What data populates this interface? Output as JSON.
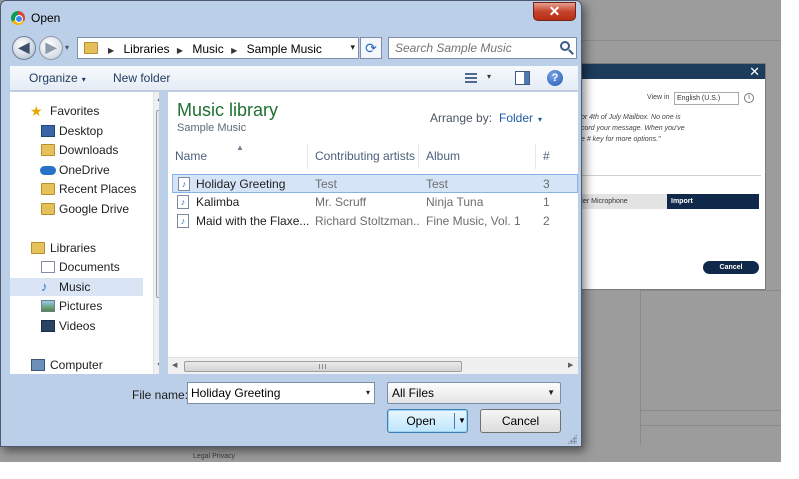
{
  "background_page": {
    "view_in_label": "View in",
    "language_value": "English (U.S.)",
    "help_icon": "help-circle-icon",
    "body_text": [
      "or 4th of July Mailbox. No one is",
      "cord your message. When you've",
      "e # key for more options.\""
    ],
    "microphone_tab": "ter Microphone",
    "import_tab": "Import",
    "cancel_label": "Cancel",
    "footer": "Legal  Privacy",
    "close_glyph": "✕"
  },
  "dialog": {
    "title": "Open",
    "close_glyph": "✕",
    "back_glyph": "◀",
    "forward_glyph": "▶",
    "nav_history_glyph": "▾",
    "breadcrumbs": [
      "Libraries",
      "Music",
      "Sample Music"
    ],
    "crumb_sep": "▶",
    "dropdown_glyph": "▾",
    "refresh_glyph": "⟳",
    "search_placeholder": "Search Sample Music"
  },
  "toolbar": {
    "organize_label": "Organize",
    "new_folder_label": "New folder",
    "caret": "▾",
    "help_glyph": "?"
  },
  "sidebar": {
    "items": [
      {
        "label": "Favorites",
        "icon": "star-icon"
      },
      {
        "label": "Desktop",
        "icon": "desktop-icon"
      },
      {
        "label": "Downloads",
        "icon": "downloads-folder-icon"
      },
      {
        "label": "OneDrive",
        "icon": "onedrive-cloud-icon"
      },
      {
        "label": "Recent Places",
        "icon": "recent-places-icon"
      },
      {
        "label": "Google Drive",
        "icon": "google-drive-folder-icon"
      },
      {
        "label": "Libraries",
        "icon": "libraries-icon"
      },
      {
        "label": "Documents",
        "icon": "documents-icon"
      },
      {
        "label": "Music",
        "icon": "music-icon",
        "selected": true
      },
      {
        "label": "Pictures",
        "icon": "pictures-icon"
      },
      {
        "label": "Videos",
        "icon": "videos-icon"
      },
      {
        "label": "Computer",
        "icon": "computer-icon"
      }
    ],
    "star_glyph": "★",
    "music_glyph": "♪",
    "scroll_up": "▲",
    "scroll_down": "▼"
  },
  "content": {
    "library_title": "Music library",
    "library_subtitle": "Sample Music",
    "arrange_label": "Arrange by:",
    "arrange_value": "Folder",
    "sort_glyph": "▲",
    "columns": [
      "Name",
      "Contributing artists",
      "Album",
      "#"
    ],
    "rows": [
      {
        "name": "Holiday Greeting",
        "artist": "Test",
        "album": "Test",
        "track": "3",
        "selected": true
      },
      {
        "name": "Kalimba",
        "artist": "Mr. Scruff",
        "album": "Ninja Tuna",
        "track": "1"
      },
      {
        "name": "Maid with the Flaxe...",
        "artist": "Richard Stoltzman...",
        "album": "Fine Music, Vol. 1",
        "track": "2"
      }
    ],
    "file_glyph": "♪",
    "scroll_left": "◀",
    "scroll_right": "▶"
  },
  "footer": {
    "file_name_label": "File name:",
    "file_name_value": "Holiday Greeting",
    "file_type_value": "All Files",
    "open_label": "Open",
    "cancel_label": "Cancel",
    "drop_glyph": "▾",
    "select_drop_glyph": "▼"
  },
  "colors": {
    "library_title": "#1e6f30",
    "selection": "#d5e5f7",
    "frame": "#bccfe8",
    "web_header": "#1d3c5c"
  }
}
